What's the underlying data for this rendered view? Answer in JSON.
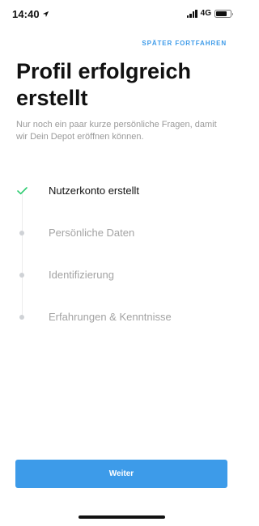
{
  "status_bar": {
    "time": "14:40",
    "network": "4G",
    "battery_level": 0.75,
    "icons": [
      "location-arrow-icon",
      "signal-icon",
      "battery-icon"
    ]
  },
  "header": {
    "skip_label": "SPÄTER FORTFAHREN"
  },
  "main": {
    "title": "Profil erfolgreich erstellt",
    "subtitle": "Nur noch ein paar kurze persönliche Fragen, damit wir Dein Depot eröffnen können."
  },
  "steps": [
    {
      "label": "Nutzerkonto erstellt",
      "status": "done",
      "icon": "checkmark-icon"
    },
    {
      "label": "Persönliche Daten",
      "status": "pending",
      "icon": "dot-icon"
    },
    {
      "label": "Identifizierung",
      "status": "pending",
      "icon": "dot-icon"
    },
    {
      "label": "Erfahrungen & Kenntnisse",
      "status": "pending",
      "icon": "dot-icon"
    }
  ],
  "footer": {
    "continue_label": "Weiter"
  },
  "colors": {
    "accent": "#3d9be9",
    "check": "#2ecc71",
    "text_primary": "#111111",
    "text_muted": "#a3a3a3"
  }
}
